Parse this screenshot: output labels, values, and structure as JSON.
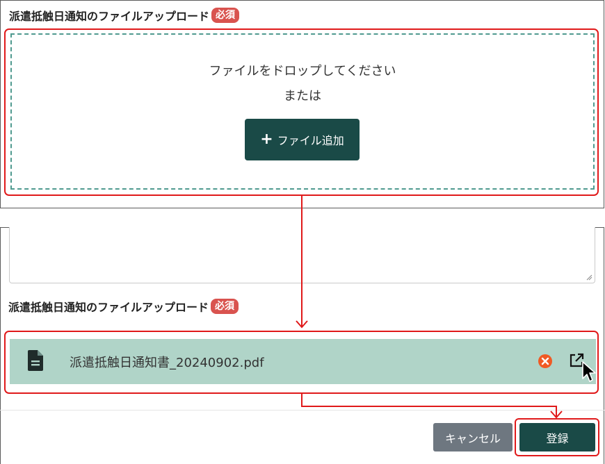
{
  "upload_section": {
    "label": "派遣抵触日通知のファイルアップロード",
    "required_badge": "必須",
    "drop_text": "ファイルをドロップしてください",
    "or_text": "または",
    "add_button_plus": "+",
    "add_button_label": "ファイル追加"
  },
  "result_section": {
    "label": "派遣抵触日通知のファイルアップロード",
    "required_badge": "必須",
    "file_name": "派遣抵触日通知書_20240902.pdf"
  },
  "footer": {
    "cancel_label": "キャンセル",
    "register_label": "登録"
  },
  "icons": {
    "file": "file-icon",
    "remove": "remove-file-icon",
    "open": "open-external-icon",
    "cursor": "mouse-cursor-icon"
  },
  "colors": {
    "primary": "#1a4a47",
    "required_badge": "#d9534f",
    "highlight_frame": "#e0191a",
    "dropzone_border": "#4f9a8f",
    "file_row_bg": "#b0d4c8",
    "remove_icon": "#f05a24",
    "cancel_bg": "#6e7780"
  }
}
